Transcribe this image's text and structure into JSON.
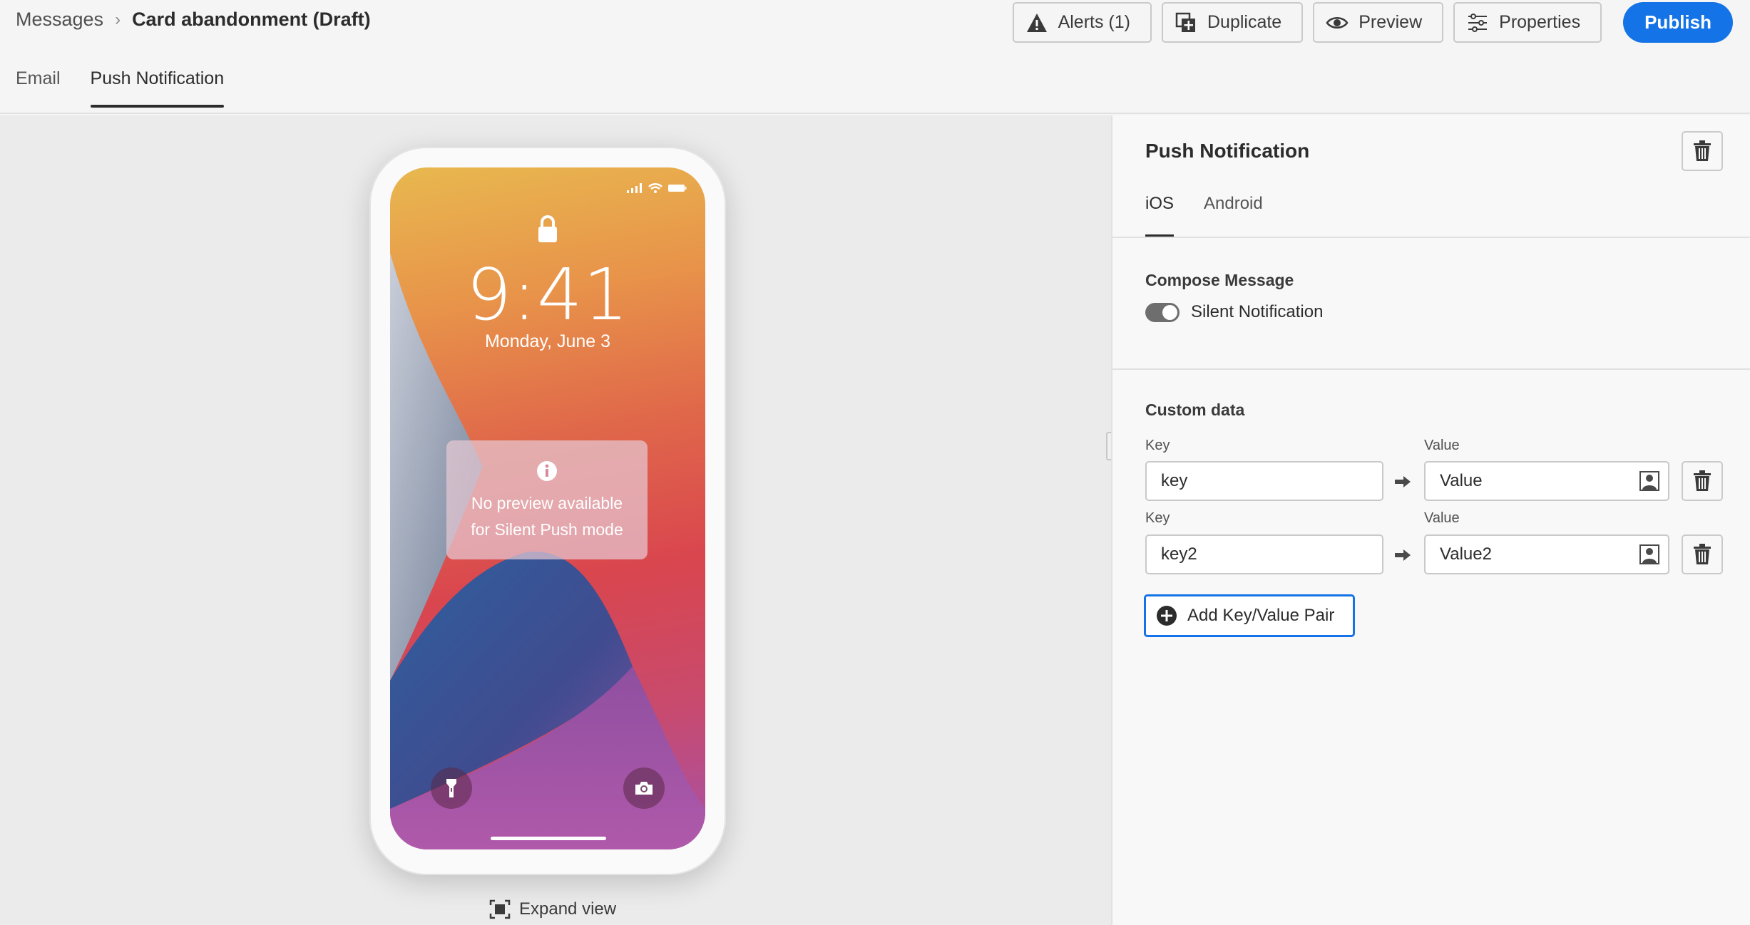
{
  "breadcrumb": {
    "parent": "Messages",
    "separator": "›",
    "current": "Card abandonment (Draft)"
  },
  "toolbar": {
    "alerts_label": "Alerts (1)",
    "duplicate_label": "Duplicate",
    "preview_label": "Preview",
    "properties_label": "Properties",
    "publish_label": "Publish"
  },
  "channel_tabs": [
    {
      "label": "Email",
      "active": false
    },
    {
      "label": "Push Notification",
      "active": true
    }
  ],
  "phone": {
    "time": "9:41",
    "date": "Monday, June 3",
    "preview_message_line1": "No preview available",
    "preview_message_line2": "for Silent Push mode"
  },
  "expand_label": "Expand view",
  "panel": {
    "title": "Push Notification",
    "tabs": [
      {
        "label": "iOS",
        "active": true
      },
      {
        "label": "Android",
        "active": false
      }
    ],
    "compose_title": "Compose Message",
    "silent_label": "Silent Notification",
    "silent_enabled": true,
    "custom_data_title": "Custom data",
    "key_label": "Key",
    "value_label": "Value",
    "pairs": [
      {
        "key": "key",
        "value": "Value"
      },
      {
        "key": "key2",
        "value": "Value2"
      }
    ],
    "add_label": "Add Key/Value Pair"
  },
  "colors": {
    "accent": "#1473e6",
    "toggle": "#6e6e6e"
  }
}
